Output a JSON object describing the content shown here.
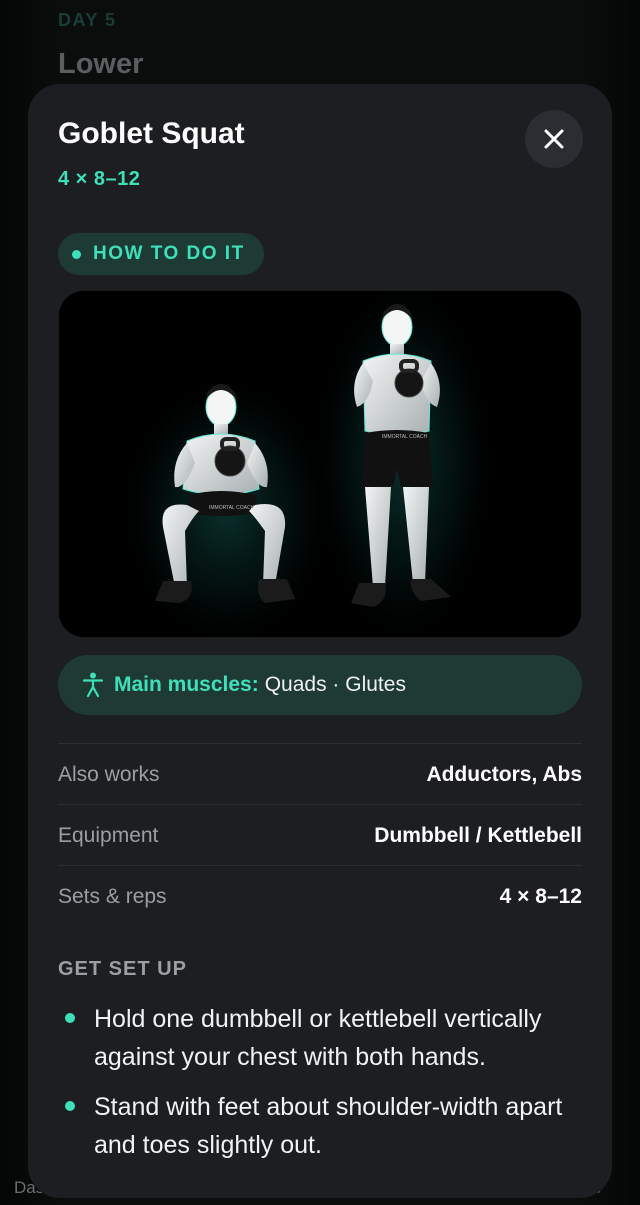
{
  "background": {
    "day_label": "DAY 5",
    "session_title": "Lower",
    "tab_left_partial": "Das",
    "tab_right_partial": "e"
  },
  "exercise": {
    "title": "Goblet Squat",
    "scheme": "4 × 8–12"
  },
  "close_icon": "close-icon",
  "how_to": {
    "label": "HOW TO DO IT"
  },
  "figure": {
    "shorts_text": "IMMORTAL COACH"
  },
  "muscles": {
    "icon": "person-icon",
    "label": "Main muscles:",
    "value": "Quads · Glutes"
  },
  "details": [
    {
      "key": "Also works",
      "value": "Adductors, Abs"
    },
    {
      "key": "Equipment",
      "value": "Dumbbell / Kettlebell"
    },
    {
      "key": "Sets & reps",
      "value": "4 × 8–12"
    }
  ],
  "setup": {
    "heading": "GET SET UP",
    "steps": [
      "Hold one dumbbell or kettlebell vertically against your chest with both hands.",
      "Stand with feet about shoulder-width apart and toes slightly out."
    ]
  },
  "colors": {
    "accent": "#3ee0b9",
    "sheet": "#1c1e21",
    "pill": "#1e3a34"
  }
}
